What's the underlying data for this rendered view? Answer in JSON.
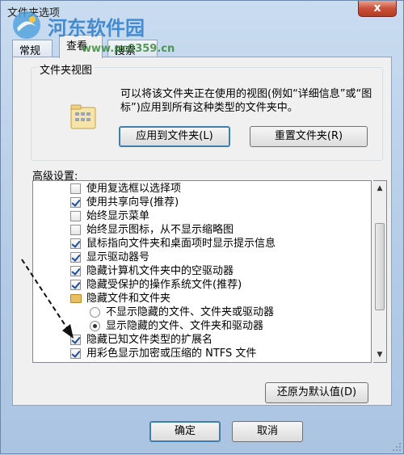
{
  "window": {
    "title": "文件夹选项",
    "close_label": "x"
  },
  "watermark": {
    "title": "河东软件园",
    "url": "www.pc0359.cn"
  },
  "tabs": [
    {
      "label": "常规"
    },
    {
      "label": "查看"
    },
    {
      "label": "搜索"
    }
  ],
  "folder_view": {
    "title": "文件夹视图",
    "description": "可以将该文件夹正在使用的视图(例如“详细信息”或“图标”)应用到所有这种类型的文件夹中。",
    "apply_button": "应用到文件夹(L)",
    "reset_button": "重置文件夹(R)"
  },
  "advanced": {
    "label": "高级设置:",
    "items": [
      {
        "text": "使用复选框以选择项",
        "type": "checkbox",
        "checked": false
      },
      {
        "text": "使用共享向导(推荐)",
        "type": "checkbox",
        "checked": true
      },
      {
        "text": "始终显示菜单",
        "type": "checkbox",
        "checked": false
      },
      {
        "text": "始终显示图标，从不显示缩略图",
        "type": "checkbox",
        "checked": false
      },
      {
        "text": "鼠标指向文件夹和桌面项时显示提示信息",
        "type": "checkbox",
        "checked": true
      },
      {
        "text": "显示驱动器号",
        "type": "checkbox",
        "checked": true
      },
      {
        "text": "隐藏计算机文件夹中的空驱动器",
        "type": "checkbox",
        "checked": true
      },
      {
        "text": "隐藏受保护的操作系统文件(推荐)",
        "type": "checkbox",
        "checked": true
      },
      {
        "text": "隐藏文件和文件夹",
        "type": "folder",
        "checked": false
      },
      {
        "text": "不显示隐藏的文件、文件夹或驱动器",
        "type": "radio",
        "checked": false
      },
      {
        "text": "显示隐藏的文件、文件夹和驱动器",
        "type": "radio",
        "checked": true
      },
      {
        "text": "隐藏已知文件类型的扩展名",
        "type": "checkbox",
        "checked": true
      },
      {
        "text": "用彩色显示加密或压缩的 NTFS 文件",
        "type": "checkbox",
        "checked": true
      }
    ],
    "restore_button": "还原为默认值(D)"
  },
  "footer": {
    "ok_button": "确定",
    "cancel_button": "取消"
  },
  "colors": {
    "window_bg": "#bcd3ec",
    "panel_bg": "#f0f0f0",
    "close_red": "#c9503a"
  }
}
